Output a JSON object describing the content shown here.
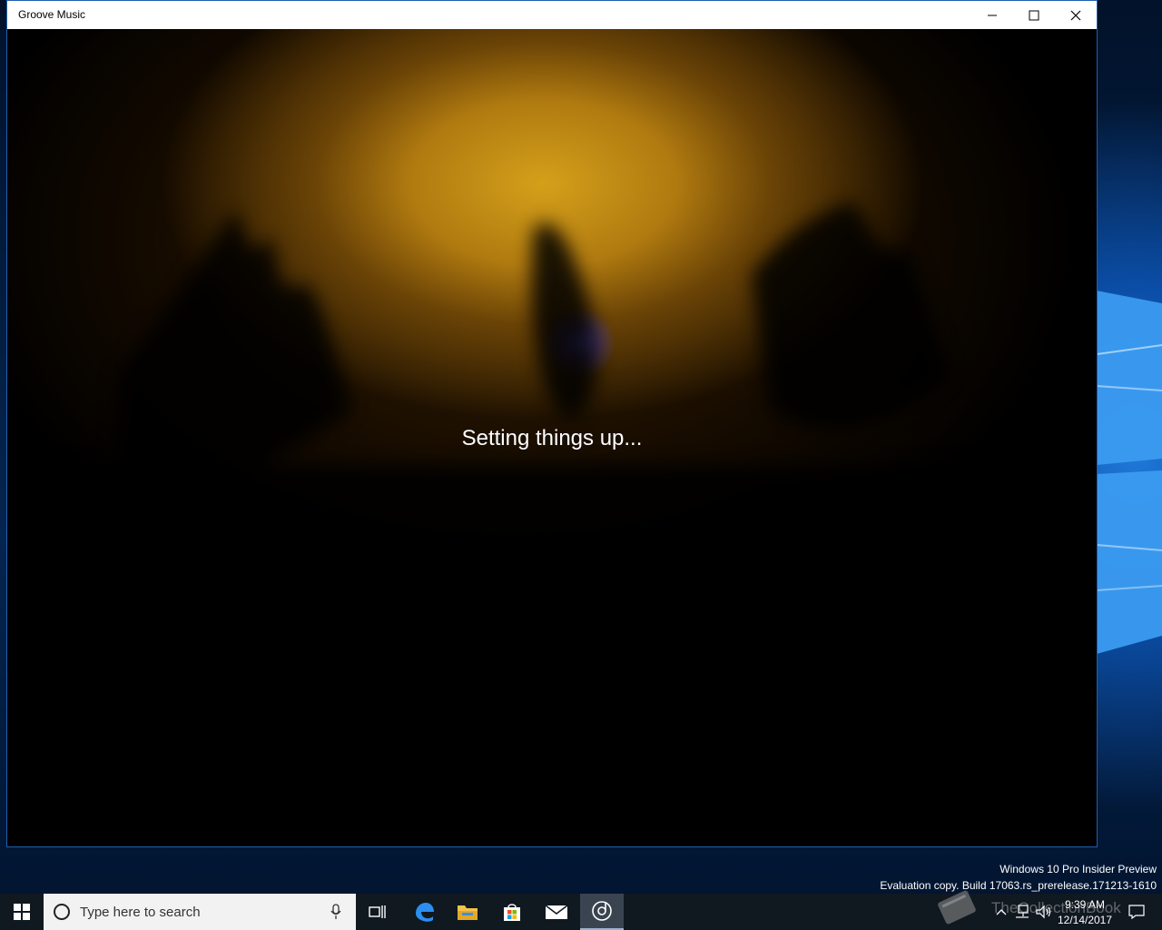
{
  "window": {
    "title": "Groove Music",
    "controls": {
      "minimize": "minimize-icon",
      "maximize": "maximize-icon",
      "close": "close-icon"
    }
  },
  "content": {
    "status_text": "Setting things up..."
  },
  "desktop": {
    "watermark_line1": "Windows 10 Pro Insider Preview",
    "watermark_line2": "Evaluation copy. Build 17063.rs_prerelease.171213-1610"
  },
  "taskbar": {
    "search_placeholder": "Type here to search",
    "pinned": [
      "start-icon",
      "cortana-icon",
      "microphone-icon",
      "task-view-icon",
      "edge-icon",
      "file-explorer-icon",
      "store-icon",
      "mail-icon",
      "groove-music-icon"
    ],
    "clock_time": "9:39 AM",
    "clock_date": "12/14/2017",
    "tray_icons": [
      "overflow-chevron-icon",
      "network-icon",
      "volume-icon",
      "action-center-icon"
    ],
    "overlay_watermark": "TheCollectionBook"
  },
  "colors": {
    "accent": "#1e5fb0",
    "taskbar": "#101820",
    "glow": "#d4a01a"
  }
}
